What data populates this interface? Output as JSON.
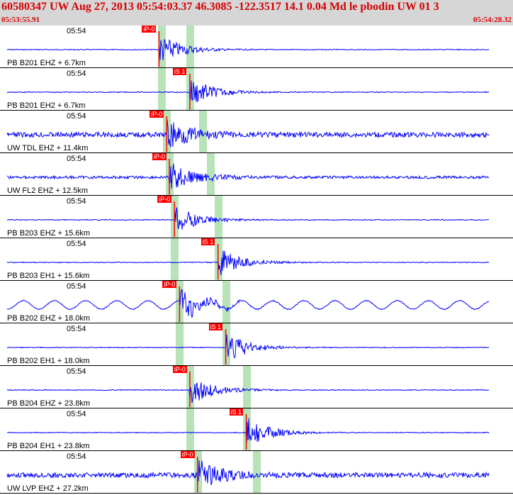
{
  "header": {
    "title": "60580347 UW Aug 27, 2013 05:54:03.37    46.3085 -122.3517 14.1 0.04 Md le pbodin UW 01    3",
    "time_start": "05:53:55.91",
    "time_end": "05:54:28.32"
  },
  "colors": {
    "trace": "#0000ff",
    "pick": "#ff0000",
    "band": "#b8e2b8",
    "header_bg": "#d6d6d6",
    "title": "#d40000"
  },
  "traces": [
    {
      "time_label": "05:54",
      "station": "PB B201 EHZ + 6.7km",
      "pick_label": "iP-0",
      "pick_time": 0.31,
      "signal": "quiet",
      "band": 0.315,
      "band2": 0.37
    },
    {
      "time_label": "05:54",
      "station": "PB B201 EH2 + 6.7km",
      "pick_label": "iS 1",
      "pick_time": 0.37,
      "signal": "quiet",
      "band": 0.315,
      "band2": 0.37
    },
    {
      "time_label": "05:54",
      "station": "UW TDL EHZ + 11.4km",
      "pick_label": "iP-0",
      "pick_time": 0.325,
      "signal": "noisy",
      "band": 0.325,
      "band2": 0.395
    },
    {
      "time_label": "05:54",
      "station": "UW FL2 EHZ + 12.5km",
      "pick_label": "iP-0",
      "pick_time": 0.33,
      "signal": "medium",
      "band": 0.33,
      "band2": 0.41
    },
    {
      "time_label": "05:54",
      "station": "PB B203 EHZ + 15.6km",
      "pick_label": "iP-0",
      "pick_time": 0.34,
      "signal": "quiet",
      "band": 0.34,
      "band2": 0.425
    },
    {
      "time_label": "05:54",
      "station": "PB B203 EH1 + 15.6km",
      "pick_label": "iS 1",
      "pick_time": 0.425,
      "signal": "quiet",
      "band": 0.34,
      "band2": 0.425
    },
    {
      "time_label": "05:54",
      "station": "PB B202 EHZ + 18.0km",
      "pick_label": "iP-0",
      "pick_time": 0.35,
      "signal": "wavy",
      "band": 0.35,
      "band2": 0.44
    },
    {
      "time_label": "05:54",
      "station": "PB B202 EH1 + 18.0km",
      "pick_label": "iS 1",
      "pick_time": 0.44,
      "signal": "quiet",
      "band": 0.35,
      "band2": 0.44
    },
    {
      "time_label": "05:54",
      "station": "PB B204 EHZ + 23.8km",
      "pick_label": "iP-0",
      "pick_time": 0.37,
      "signal": "quiet",
      "band": 0.37,
      "band2": 0.48
    },
    {
      "time_label": "05:54",
      "station": "PB B204 EH1 + 23.8km",
      "pick_label": "iS 1",
      "pick_time": 0.48,
      "signal": "quiet",
      "band": 0.37,
      "band2": 0.48
    },
    {
      "time_label": "05:54",
      "station": "UW LVP EHZ + 27.2km",
      "pick_label": "iP-0",
      "pick_time": 0.385,
      "signal": "noisy",
      "band": 0.385,
      "band2": 0.5
    }
  ]
}
